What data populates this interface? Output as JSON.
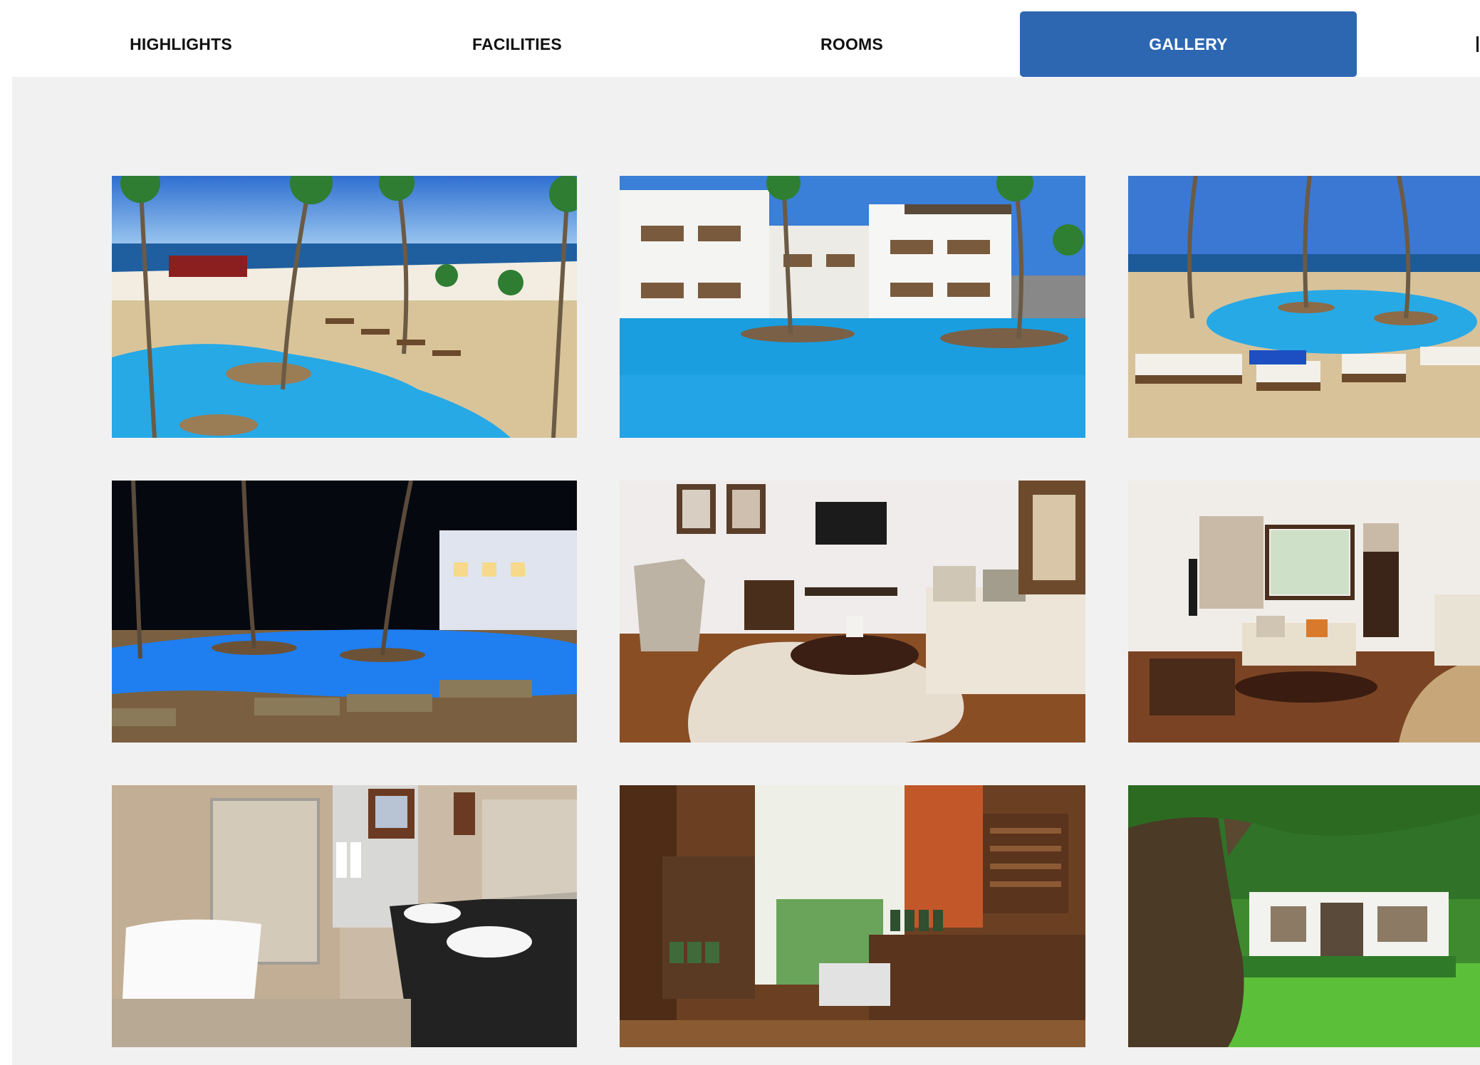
{
  "tabs": [
    {
      "label": "HIGHLIGHTS",
      "active": false
    },
    {
      "label": "FACILITIES",
      "active": false
    },
    {
      "label": "ROOMS",
      "active": false
    },
    {
      "label": "GALLERY",
      "active": true
    }
  ],
  "colors": {
    "active_tab": "#2d67b2",
    "panel_background": "#f1f1f1"
  },
  "gallery": {
    "photos": [
      {
        "subject": "beach-pool-aerial"
      },
      {
        "subject": "hotel-pool-view"
      },
      {
        "subject": "pool-sunbeds"
      },
      {
        "subject": "night-pool"
      },
      {
        "subject": "living-room"
      },
      {
        "subject": "suite-lounge"
      },
      {
        "subject": "bathroom"
      },
      {
        "subject": "boutique-shop"
      },
      {
        "subject": "garden-tree"
      }
    ]
  }
}
